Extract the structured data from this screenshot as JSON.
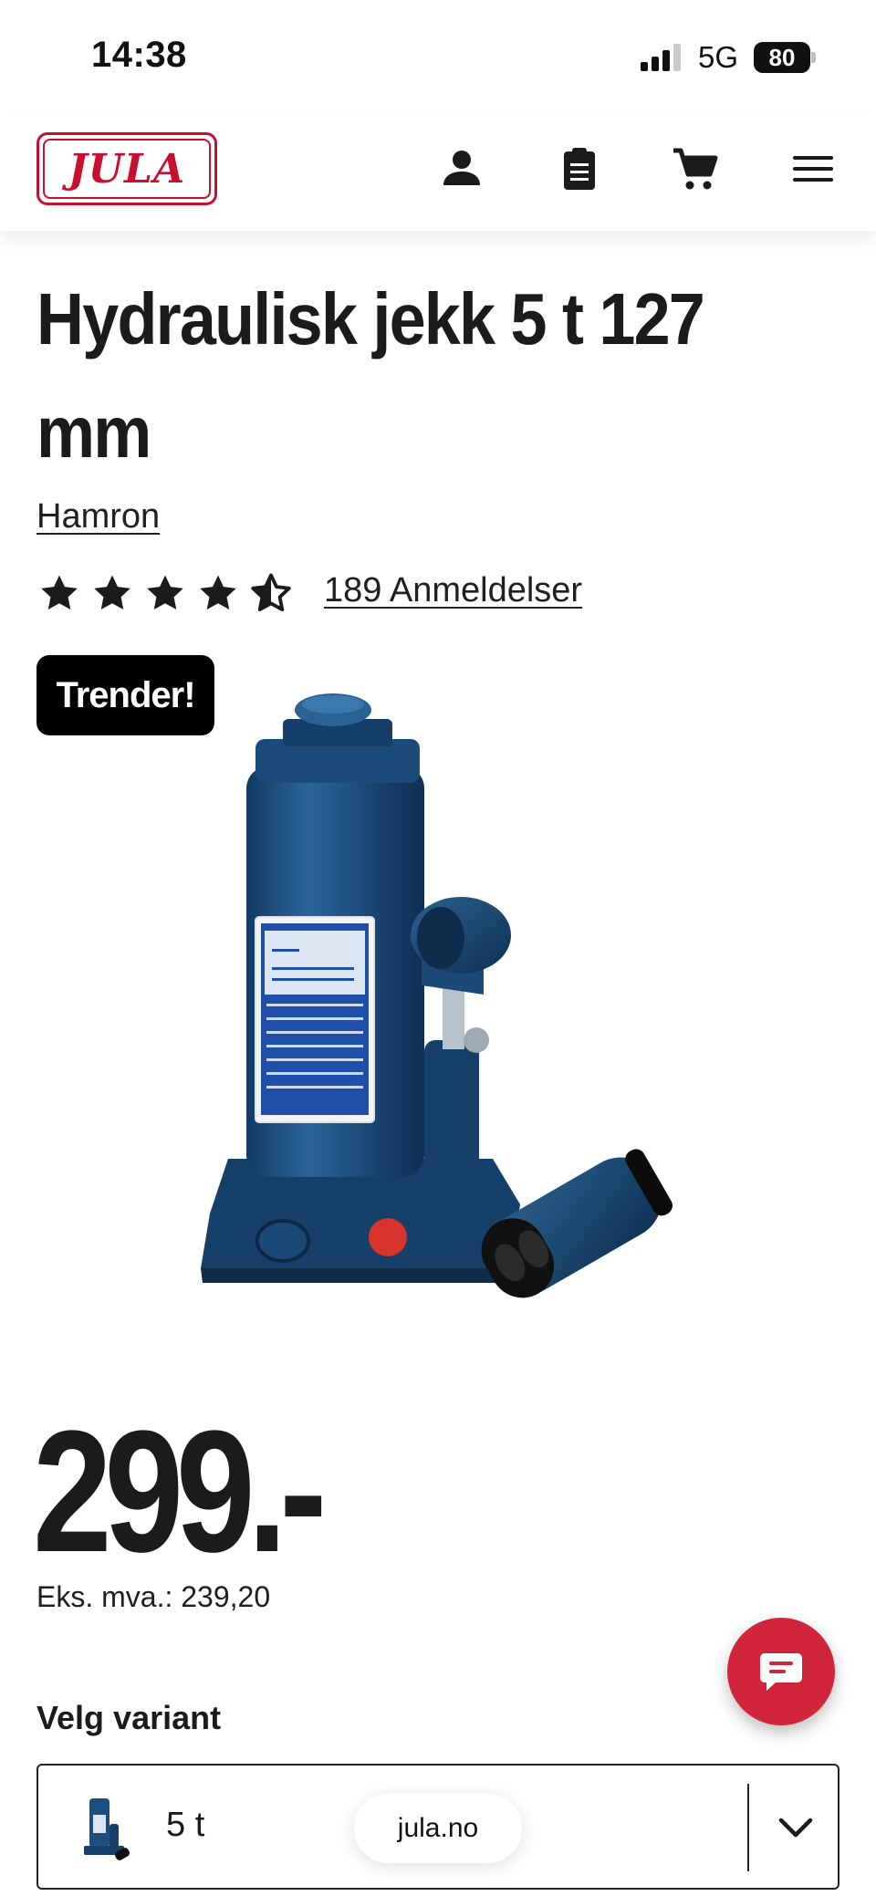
{
  "status_bar": {
    "time": "14:38",
    "network": "5G",
    "battery": "80"
  },
  "header": {
    "logo_text": "JULA",
    "icons": [
      "account-icon",
      "shopping-list-icon",
      "cart-icon",
      "menu-icon"
    ]
  },
  "product": {
    "title": "Hydraulisk jekk 5 t 127 mm",
    "brand": "Hamron",
    "rating": 4.5,
    "rating_max": 5,
    "reviews": "189 Anmeldelser",
    "badge": "Trender!",
    "price": "299.-",
    "price_ex_vat": "Eks. mva.: 239,20"
  },
  "variant": {
    "label": "Velg variant",
    "selected": "5 t"
  },
  "browser": {
    "url": "jula.no"
  },
  "colors": {
    "brand_red": "#c8102e",
    "chat_red": "#d0253a",
    "text": "#1b1b1b",
    "jack_blue": "#1d4e7e"
  }
}
